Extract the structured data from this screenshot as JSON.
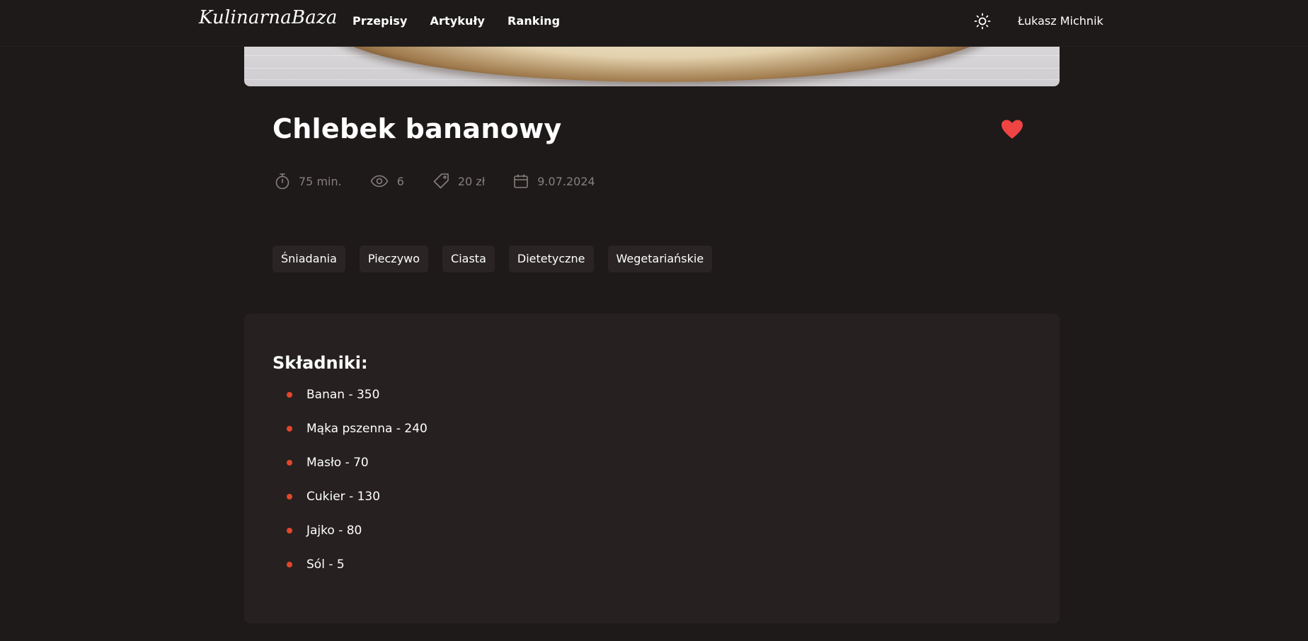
{
  "nav": {
    "logo": "KulinarnaBaza",
    "links": [
      "Przepisy",
      "Artykuły",
      "Ranking"
    ],
    "theme_icon": "sun-icon",
    "user_name": "Łukasz Michnik"
  },
  "recipe": {
    "title": "Chlebek bananowy",
    "favorite": true,
    "favorite_icon": "heart-icon",
    "meta": {
      "time": "75 min.",
      "views": "6",
      "price": "20 zł",
      "date": "9.07.2024"
    },
    "tags": [
      "Śniadania",
      "Pieczywo",
      "Ciasta",
      "Dietetyczne",
      "Wegetariańskie"
    ]
  },
  "ingredients": {
    "title": "Składniki:",
    "items": [
      "Banan - 350",
      "Mąka pszenna - 240",
      "Masło - 70",
      "Cukier - 130",
      "Jajko - 80",
      "Sól - 5"
    ]
  },
  "colors": {
    "background": "#1e1a19",
    "card": "#262120",
    "tag": "#2a2524",
    "accent_heart": "#ef4444",
    "bullet": "#e5452b",
    "muted_text": "#85807e"
  }
}
